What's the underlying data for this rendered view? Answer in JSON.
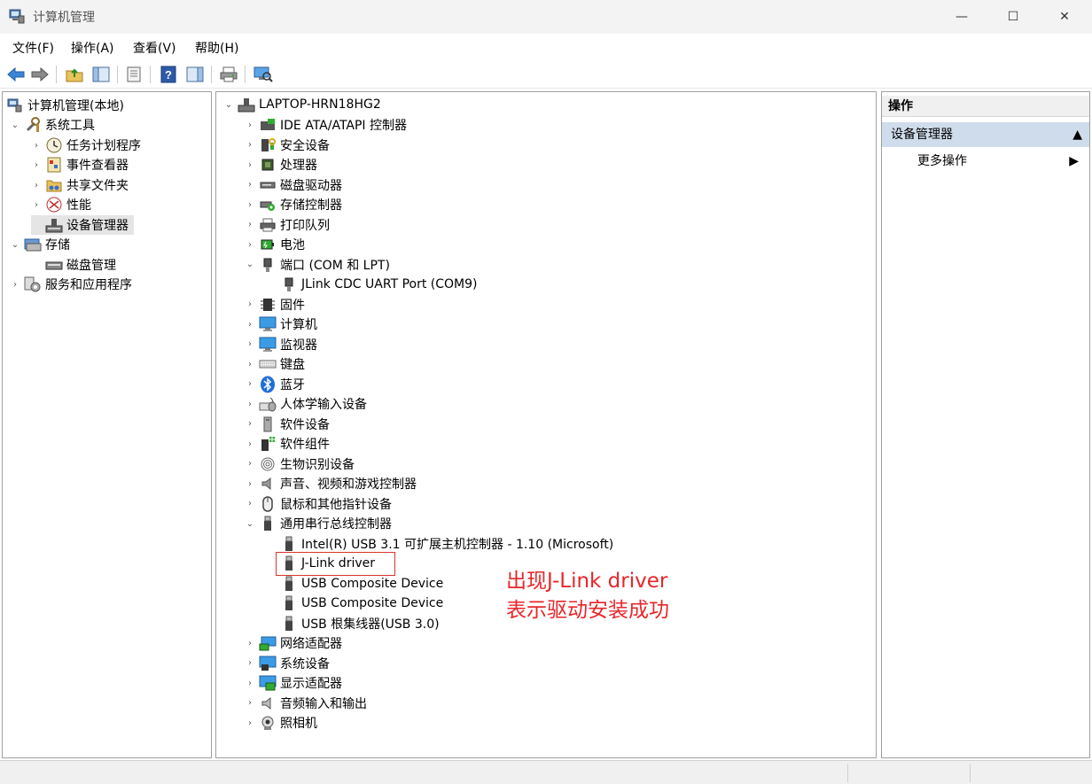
{
  "window": {
    "title": "计算机管理",
    "minimize_glyph": "—",
    "maximize_glyph": "☐",
    "close_glyph": "✕"
  },
  "menu": [
    "文件(F)",
    "操作(A)",
    "查看(V)",
    "帮助(H)"
  ],
  "toolbar": {
    "buttons": [
      "back-icon",
      "forward-icon",
      "up-folder-icon",
      "show-hide-tree-icon",
      "properties-icon",
      "help-icon",
      "show-hide-action-pane-icon",
      "print-icon",
      "scan-hardware-icon"
    ]
  },
  "left_tree": {
    "root": "计算机管理(本地)",
    "system_tools": "系统工具",
    "task_scheduler": "任务计划程序",
    "event_viewer": "事件查看器",
    "shared_folders": "共享文件夹",
    "performance": "性能",
    "device_manager": "设备管理器",
    "storage": "存储",
    "disk_management": "磁盘管理",
    "services_apps": "服务和应用程序"
  },
  "device_tree": {
    "computer": "LAPTOP-HRN18HG2",
    "ide": "IDE ATA/ATAPI 控制器",
    "security": "安全设备",
    "processor": "处理器",
    "disk_drives": "磁盘驱动器",
    "storage_ctrl": "存储控制器",
    "print_queue": "打印队列",
    "battery": "电池",
    "ports": "端口 (COM 和 LPT)",
    "jlink_cdc": "JLink CDC UART Port (COM9)",
    "firmware": "固件",
    "computer_cat": "计算机",
    "monitors": "监视器",
    "keyboards": "键盘",
    "bluetooth": "蓝牙",
    "hid": "人体学输入设备",
    "software_devices": "软件设备",
    "software_components": "软件组件",
    "biometric": "生物识别设备",
    "sound": "声音、视频和游戏控制器",
    "mice": "鼠标和其他指针设备",
    "usb_ctrl": "通用串行总线控制器",
    "usb_intel": "Intel(R) USB 3.1 可扩展主机控制器 - 1.10 (Microsoft)",
    "usb_jlink": "J-Link driver",
    "usb_comp1": "USB Composite Device",
    "usb_comp2": "USB Composite Device",
    "usb_hub": "USB 根集线器(USB 3.0)",
    "network": "网络适配器",
    "system_devices": "系统设备",
    "display": "显示适配器",
    "audio_io": "音频输入和输出",
    "cameras": "照相机"
  },
  "actions_pane": {
    "header": "操作",
    "section": "设备管理器",
    "more": "更多操作"
  },
  "annotation": {
    "line1": "出现J-Link driver",
    "line2": "表示驱动安装成功",
    "color": "#e8262a"
  }
}
